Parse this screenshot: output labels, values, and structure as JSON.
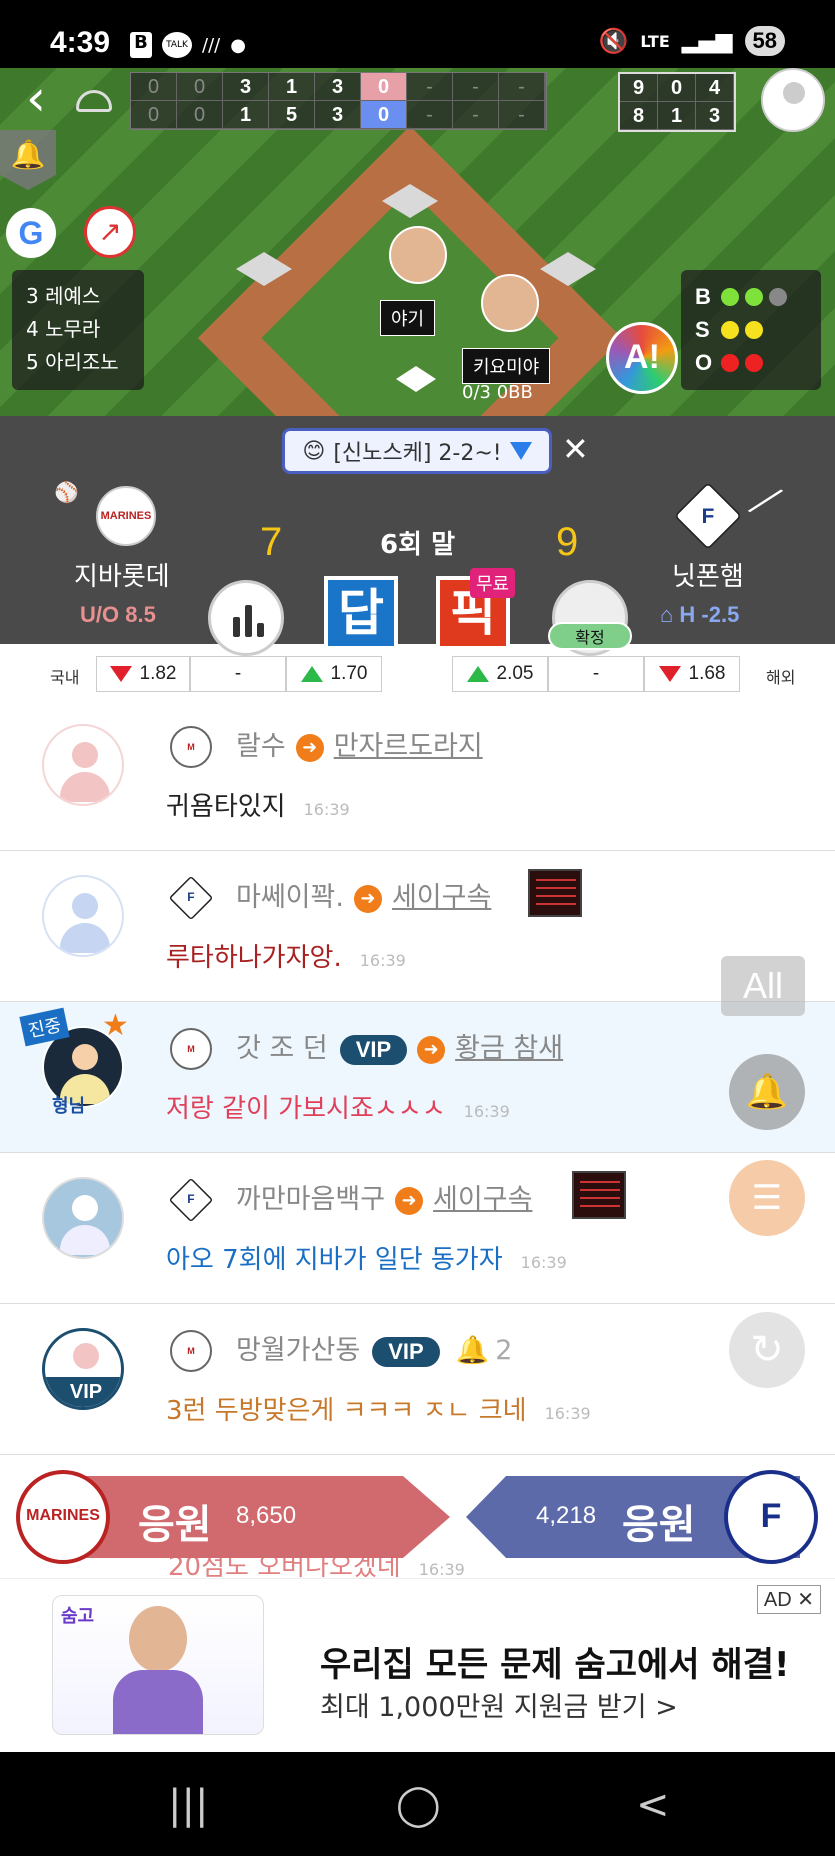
{
  "status_bar": {
    "time": "4:39",
    "icons": [
      "b-app-icon",
      "talk-icon",
      "slash-icon",
      "dot-icon"
    ],
    "network": "LTE",
    "battery": "58"
  },
  "scoreboard": {
    "top": [
      "0",
      "0",
      "3",
      "1",
      "3",
      "0",
      "-",
      "-",
      "-"
    ],
    "bottom": [
      "0",
      "0",
      "1",
      "5",
      "3",
      "0",
      "-",
      "-",
      "-"
    ],
    "rhe_top": [
      "9",
      "0",
      "4"
    ],
    "rhe_bottom": [
      "8",
      "1",
      "3"
    ]
  },
  "lineup": [
    "3 레예스",
    "4 노무라",
    "5 아리조노"
  ],
  "players": {
    "fielder_tag": "야기",
    "batter_tag": "키요미야",
    "batter_stat": "0/3 0BB"
  },
  "bso": {
    "b": "B",
    "s": "S",
    "o": "O"
  },
  "notice": {
    "text": "[신노스케] 2-2~!",
    "close": "✕"
  },
  "away": {
    "name": "지바롯데",
    "sub": "U/O 8.5",
    "score": "7",
    "logo": "MARINES"
  },
  "home": {
    "name": "닛폰햄",
    "sub": "H -2.5",
    "score": "9",
    "logo": "F"
  },
  "inning": "6회 말",
  "buttons": {
    "dap": "답",
    "pick": "픽",
    "free": "무료",
    "confirmed": "확정"
  },
  "odds": {
    "domestic_label": "국내",
    "overseas_label": "해외",
    "domestic": [
      "1.82",
      "-",
      "1.70"
    ],
    "overseas": [
      "2.05",
      "-",
      "1.68"
    ]
  },
  "messages": [
    {
      "user": "랄수",
      "target": "만자르도라지",
      "text": "귀욤타있지",
      "time": "16:39",
      "team": "marines",
      "text_color": "#222222"
    },
    {
      "user": "마쎄이꽉.",
      "target": "세이구속",
      "text": "루타하나가자앙.",
      "time": "16:39",
      "team": "fighters",
      "text_color": "#a82020"
    },
    {
      "user": "갓 조 던",
      "vip": "VIP",
      "target": "황금 참새",
      "text": "저랑 같이 가보시죠ㅅㅅㅅ",
      "time": "16:39",
      "team": "marines",
      "text_color": "#e0405a",
      "badge": "진중",
      "nick": "형님"
    },
    {
      "user": "까만마음백구",
      "target": "세이구속",
      "text": "아오 7회에 지바가 일단 동가자",
      "time": "16:39",
      "team": "fighters",
      "text_color": "#1a6fc4"
    },
    {
      "user": "망월가산동",
      "vip": "VIP",
      "likes": "2",
      "text": "3런 두방맞은게 ㅋㅋㅋ ㅈㄴ 크네",
      "time": "16:39",
      "team": "marines",
      "text_color": "#c8782a",
      "avatar_vip": "VIP"
    }
  ],
  "partial_message": {
    "text": "20점도 오버나오겠네",
    "time": "16:39"
  },
  "side": {
    "all": "All"
  },
  "cheer": {
    "left_label": "응원",
    "left_count": "8,650",
    "right_label": "응원",
    "right_count": "4,218"
  },
  "ad": {
    "badge": "AD ✕",
    "brand": "숨고",
    "title": "우리집 모든 문제 숨고에서 해결!",
    "subtitle": "최대 1,000만원 지원금 받기 >"
  },
  "nav": {
    "recent": "|||",
    "home": "◯",
    "back": "<"
  },
  "colors": {
    "accent_orange": "#f07d1a",
    "vip_navy": "#1c4e70",
    "away_red": "#d06a6f",
    "home_blue": "#5d6aaa"
  }
}
